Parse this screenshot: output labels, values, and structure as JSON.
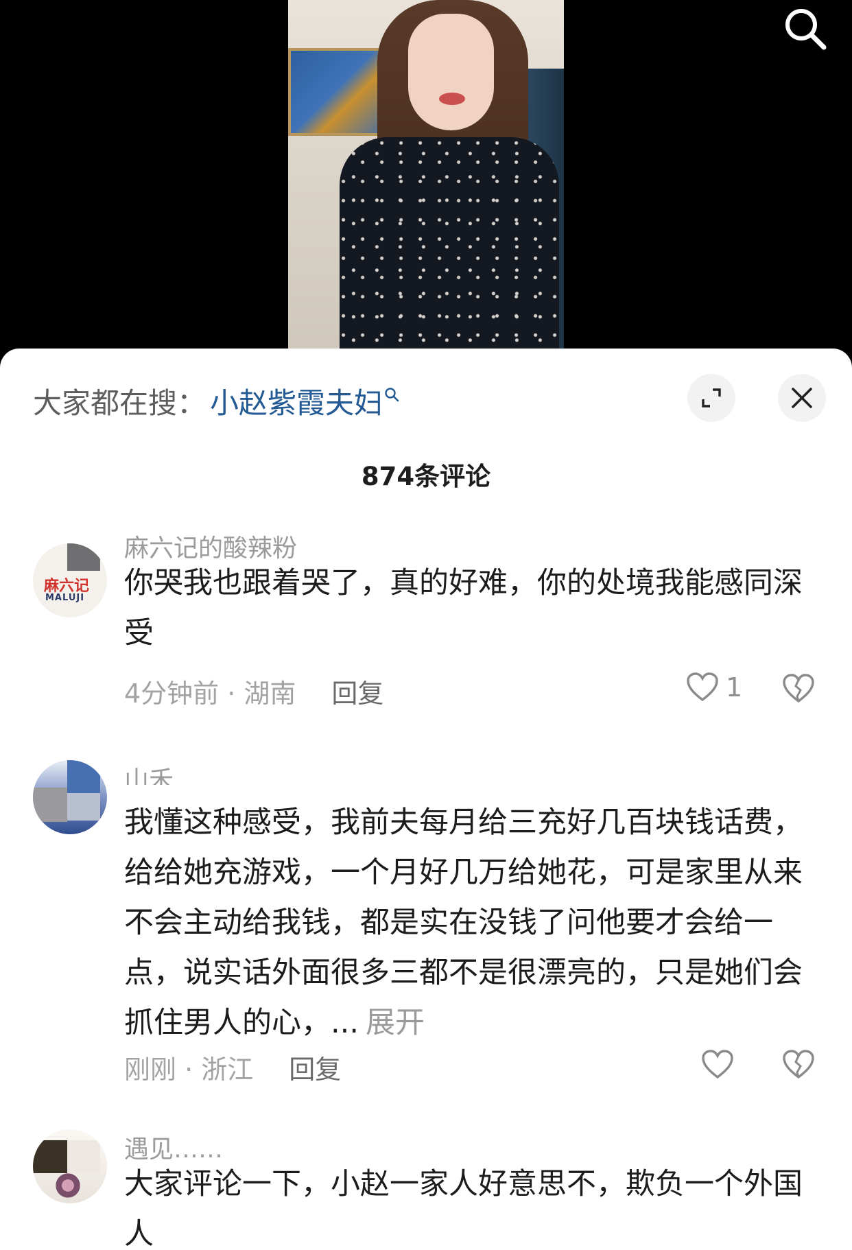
{
  "top_bar": {
    "search_icon": "search-icon"
  },
  "sheet": {
    "search_suggestion": {
      "prefix": "大家都在搜：",
      "term": "小赵紫霞夫妇",
      "term_icon": "magnifier-small-icon"
    },
    "expand_icon": "expand-icon",
    "close_icon": "close-icon",
    "comment_count": "874条评论"
  },
  "comments": [
    {
      "username": "麻六记的酸辣粉",
      "avatar_text": "麻六记",
      "avatar_subtext": "MALUJI",
      "text": "你哭我也跟着哭了，真的好难，你的处境我能感同深受",
      "meta": "4分钟前 · 湖南",
      "reply_label": "回复",
      "like_count": "1"
    },
    {
      "username": "山禾",
      "text": "我懂这种感受，我前夫每月给三充好几百块钱话费，给给她充游戏，一个月好几万给她花，可是家里从来不会主动给我钱，都是实在没钱了问他要才会给一点，说实话外面很多三都不是很漂亮的，只是她们会抓住男人的心，...",
      "expand_label": "展开",
      "meta": "刚刚 · 浙江",
      "reply_label": "回复"
    },
    {
      "username": "遇见……",
      "text": "大家评论一下，小赵一家人好意思不，欺负一个外国人"
    }
  ],
  "colors": {
    "link_blue": "#235a93",
    "text_primary": "#1c1c1c",
    "text_secondary": "#a3a3a3",
    "button_bg": "#f2f2f2"
  }
}
